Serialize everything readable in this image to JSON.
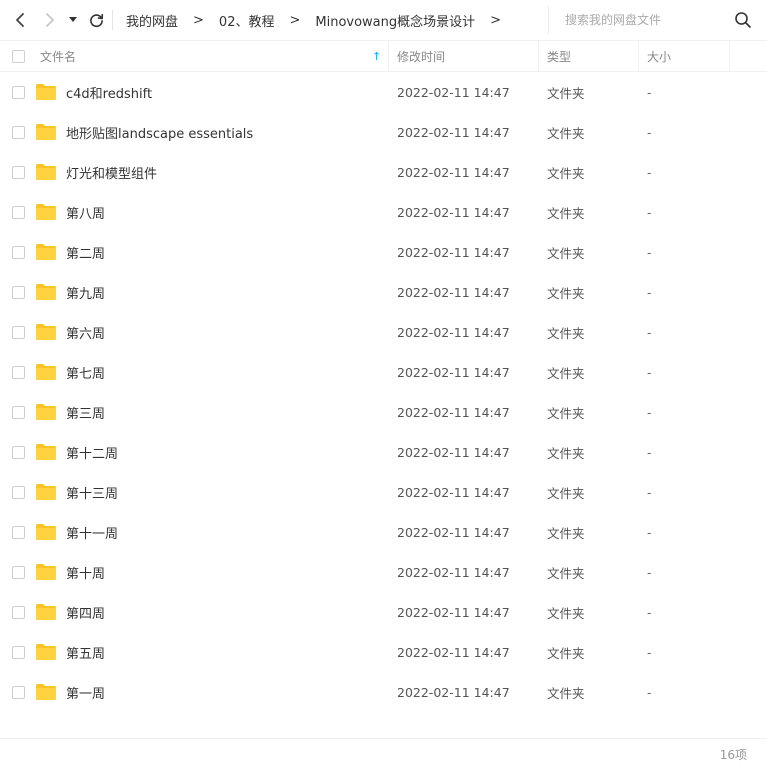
{
  "nav": {
    "back_icon": "‹",
    "forward_icon": "›",
    "dropdown_icon": "▾",
    "refresh_icon": "⟳"
  },
  "breadcrumb": {
    "items": [
      "我的网盘",
      "02、教程",
      "Minovowang概念场景设计"
    ],
    "separator": ">"
  },
  "search": {
    "placeholder": "搜索我的网盘文件",
    "icon": "search-icon"
  },
  "header": {
    "name": "文件名",
    "sort_indicator": "↑",
    "mtime": "修改时间",
    "type": "类型",
    "size": "大小"
  },
  "colors": {
    "folder": "#FFD23F",
    "folder_tab": "#F7C325",
    "accent": "#06A7FF"
  },
  "files": [
    {
      "name": "c4d和redshift",
      "mtime": "2022-02-11 14:47",
      "type": "文件夹",
      "size": "-",
      "icon": "folder-icon"
    },
    {
      "name": "地形贴图landscape essentials",
      "mtime": "2022-02-11 14:47",
      "type": "文件夹",
      "size": "-",
      "icon": "folder-icon"
    },
    {
      "name": "灯光和模型组件",
      "mtime": "2022-02-11 14:47",
      "type": "文件夹",
      "size": "-",
      "icon": "folder-icon"
    },
    {
      "name": "第八周",
      "mtime": "2022-02-11 14:47",
      "type": "文件夹",
      "size": "-",
      "icon": "folder-icon"
    },
    {
      "name": "第二周",
      "mtime": "2022-02-11 14:47",
      "type": "文件夹",
      "size": "-",
      "icon": "folder-icon"
    },
    {
      "name": "第九周",
      "mtime": "2022-02-11 14:47",
      "type": "文件夹",
      "size": "-",
      "icon": "folder-icon"
    },
    {
      "name": "第六周",
      "mtime": "2022-02-11 14:47",
      "type": "文件夹",
      "size": "-",
      "icon": "folder-icon"
    },
    {
      "name": "第七周",
      "mtime": "2022-02-11 14:47",
      "type": "文件夹",
      "size": "-",
      "icon": "folder-icon"
    },
    {
      "name": "第三周",
      "mtime": "2022-02-11 14:47",
      "type": "文件夹",
      "size": "-",
      "icon": "folder-icon"
    },
    {
      "name": "第十二周",
      "mtime": "2022-02-11 14:47",
      "type": "文件夹",
      "size": "-",
      "icon": "folder-icon"
    },
    {
      "name": "第十三周",
      "mtime": "2022-02-11 14:47",
      "type": "文件夹",
      "size": "-",
      "icon": "folder-icon"
    },
    {
      "name": "第十一周",
      "mtime": "2022-02-11 14:47",
      "type": "文件夹",
      "size": "-",
      "icon": "folder-icon"
    },
    {
      "name": "第十周",
      "mtime": "2022-02-11 14:47",
      "type": "文件夹",
      "size": "-",
      "icon": "folder-icon"
    },
    {
      "name": "第四周",
      "mtime": "2022-02-11 14:47",
      "type": "文件夹",
      "size": "-",
      "icon": "folder-icon"
    },
    {
      "name": "第五周",
      "mtime": "2022-02-11 14:47",
      "type": "文件夹",
      "size": "-",
      "icon": "folder-icon"
    },
    {
      "name": "第一周",
      "mtime": "2022-02-11 14:47",
      "type": "文件夹",
      "size": "-",
      "icon": "folder-icon"
    }
  ],
  "footer": {
    "count": "16项"
  }
}
